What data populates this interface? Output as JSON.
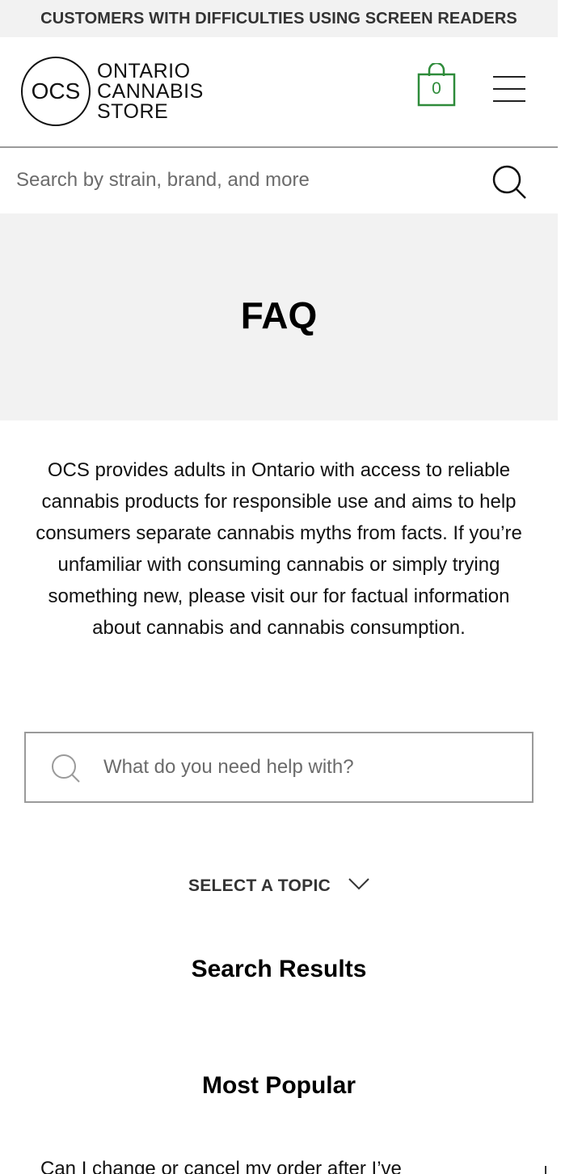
{
  "a11y_bar": {
    "link_label": "CUSTOMERS WITH DIFFICULTIES USING SCREEN READERS"
  },
  "header": {
    "logo": {
      "monogram": "OCS",
      "line1": "ONTARIO",
      "line2": "CANNABIS",
      "line3": "STORE"
    },
    "cart": {
      "count": "0",
      "icon": "shopping-bag-icon",
      "color": "#2e8b3a"
    },
    "menu": {
      "icon": "hamburger-menu-icon"
    }
  },
  "site_search": {
    "placeholder": "Search by strain, brand, and more",
    "icon": "search-icon"
  },
  "hero": {
    "title": "FAQ",
    "background": "#f2f2f2"
  },
  "intro": {
    "text": "OCS provides adults in Ontario with access to reliable cannabis products for responsible use and aims to help consumers separate cannabis myths from facts. If you’re unfamiliar with consuming cannabis or simply trying something new, please visit our for factual information about cannabis and cannabis consumption."
  },
  "faq_search": {
    "placeholder": "What do you need help with?",
    "icon": "search-icon"
  },
  "topic_select": {
    "label": "SELECT A TOPIC",
    "icon": "chevron-down-icon"
  },
  "search_results": {
    "title": "Search Results"
  },
  "most_popular": {
    "title": "Most Popular",
    "items": [
      {
        "question": "Can I change or cancel my order after I’ve"
      }
    ]
  }
}
